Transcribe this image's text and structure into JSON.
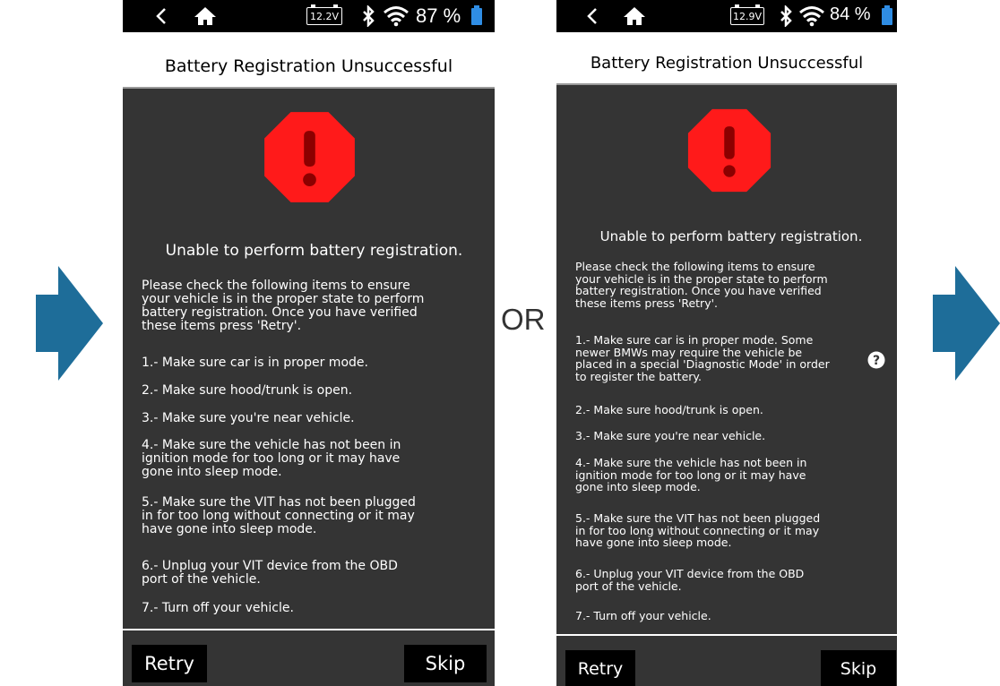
{
  "separator_text": "OR",
  "colors": {
    "arrow": "#1e6d99",
    "stop": "#ff1a1a",
    "battery": "#2f8de4",
    "screen_bg": "#343434"
  },
  "screens": [
    {
      "status": {
        "voltage": "12.2V",
        "battery_pct": "87 %"
      },
      "title": "Battery Registration Unsuccessful",
      "subtitle": "Unable to perform battery registration.",
      "intro": "Please check the following items to ensure\nyour vehicle is in the proper state to perform\nbattery registration. Once you have verified\nthese items press 'Retry'.",
      "steps": [
        "1.- Make sure car is in proper mode.",
        "2.- Make sure hood/trunk is open.",
        "3.- Make sure you're near vehicle.",
        "4.- Make sure the vehicle has not been in\nignition mode for too long or it may have\ngone into sleep mode.",
        "5.- Make sure the VIT has not been plugged\nin for too long without connecting or it may\nhave gone into sleep mode.",
        "6.- Unplug your VIT device from the OBD\nport of the vehicle.",
        "7.- Turn off your vehicle."
      ],
      "retry_label": "Retry",
      "skip_label": "Skip"
    },
    {
      "status": {
        "voltage": "12.9V",
        "battery_pct": "84 %"
      },
      "title": "Battery Registration Unsuccessful",
      "subtitle": "Unable to perform battery registration.",
      "intro": "Please check the following items to ensure\nyour vehicle is in the proper state to perform\nbattery registration. Once you have verified\nthese items press 'Retry'.",
      "steps": [
        "1.- Make sure car is in proper mode. Some\nnewer BMWs may require the vehicle be\nplaced in a special 'Diagnostic Mode' in order\nto register the battery.",
        "2.- Make sure hood/trunk is open.",
        "3.- Make sure you're near vehicle.",
        "4.- Make sure the vehicle has not been in\nignition mode for too long or it may have\ngone into sleep mode.",
        "5.- Make sure the VIT has not been plugged\nin for too long without connecting or it may\nhave gone into sleep mode.",
        "6.- Unplug your VIT device from the OBD\nport of the vehicle.",
        "7.- Turn off your vehicle."
      ],
      "retry_label": "Retry",
      "skip_label": "Skip"
    }
  ]
}
